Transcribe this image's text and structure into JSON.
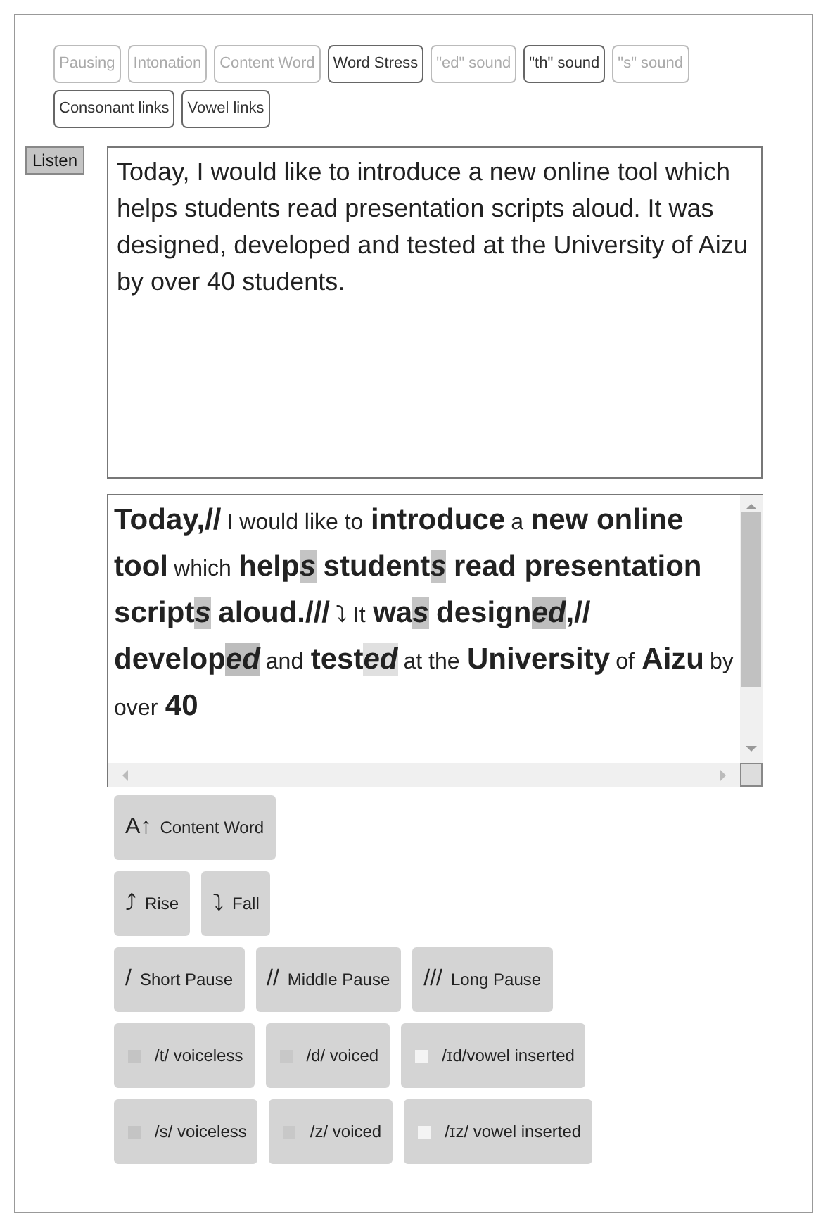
{
  "tabs": [
    {
      "label": "Pausing",
      "selected": false
    },
    {
      "label": "Intonation",
      "selected": false
    },
    {
      "label": "Content Word",
      "selected": false
    },
    {
      "label": "Word Stress",
      "selected": true
    },
    {
      "label": "\"ed\" sound",
      "selected": false
    },
    {
      "label": "\"th\" sound",
      "selected": true
    },
    {
      "label": "\"s\" sound",
      "selected": false
    },
    {
      "label": "Consonant links",
      "selected": true
    },
    {
      "label": "Vowel links",
      "selected": true
    }
  ],
  "listen_button": "Listen",
  "script_text": "Today, I would like to introduce a new online tool which helps students read presentation scripts aloud. It was designed, developed and tested at the University of Aizu by over 40 students.",
  "annotated_text": [
    {
      "kind": "content",
      "text": "Today,//"
    },
    {
      "kind": "function",
      "text": "I would like to"
    },
    {
      "kind": "content",
      "text": "introduce"
    },
    {
      "kind": "function",
      "text": "a"
    },
    {
      "kind": "content",
      "text": "new online tool"
    },
    {
      "kind": "function",
      "text": "which"
    },
    {
      "kind": "content",
      "text": "help"
    },
    {
      "kind": "mark",
      "text": "s",
      "color": "#c4c4c4"
    },
    {
      "kind": "content",
      "text": "student"
    },
    {
      "kind": "mark",
      "text": "s",
      "color": "#c4c4c4"
    },
    {
      "kind": "content",
      "text": "read presentation script"
    },
    {
      "kind": "mark",
      "text": "s",
      "color": "#c4c4c4"
    },
    {
      "kind": "content",
      "text": "aloud.///"
    },
    {
      "kind": "function",
      "text": "⤵ It"
    },
    {
      "kind": "content",
      "text": "wa"
    },
    {
      "kind": "mark",
      "text": "s",
      "color": "#c4c4c4"
    },
    {
      "kind": "content",
      "text": "design"
    },
    {
      "kind": "mark",
      "text": "ed",
      "color": "#bdbdbd"
    },
    {
      "kind": "content",
      "text": ",// develop"
    },
    {
      "kind": "mark",
      "text": "ed",
      "color": "#bdbdbd"
    },
    {
      "kind": "function",
      "text": "and"
    },
    {
      "kind": "content",
      "text": "test"
    },
    {
      "kind": "mark",
      "text": "ed",
      "color": "#e0e0e0"
    },
    {
      "kind": "function",
      "text": "at the"
    },
    {
      "kind": "content",
      "text": "University"
    },
    {
      "kind": "function",
      "text": "of"
    },
    {
      "kind": "content",
      "text": "Aizu"
    },
    {
      "kind": "function",
      "text": "by over"
    },
    {
      "kind": "content",
      "text": "40"
    }
  ],
  "legend_rows": [
    [
      {
        "kind": "symbol",
        "symbol": "A↑",
        "label": "Content Word"
      }
    ],
    [
      {
        "kind": "symbol",
        "symbol": "⤴",
        "label": "Rise"
      },
      {
        "kind": "symbol",
        "symbol": "⤵",
        "label": "Fall"
      }
    ],
    [
      {
        "kind": "symbol",
        "symbol": "/",
        "label": "Short Pause"
      },
      {
        "kind": "symbol",
        "symbol": "//",
        "label": "Middle Pause"
      },
      {
        "kind": "symbol",
        "symbol": "///",
        "label": "Long Pause"
      }
    ],
    [
      {
        "kind": "swatch",
        "color": "#c4c4c4",
        "label": "/t/ voiceless"
      },
      {
        "kind": "swatch",
        "color": "#c8c8c8",
        "label": "/d/ voiced"
      },
      {
        "kind": "swatch",
        "color": "#f4f4f4",
        "label": "/ɪd/vowel inserted"
      }
    ],
    [
      {
        "kind": "swatch",
        "color": "#c4c4c4",
        "label": "/s/ voiceless"
      },
      {
        "kind": "swatch",
        "color": "#c8c8c8",
        "label": "/z/ voiced"
      },
      {
        "kind": "swatch",
        "color": "#f4f4f4",
        "label": "/ɪz/ vowel inserted"
      }
    ]
  ]
}
